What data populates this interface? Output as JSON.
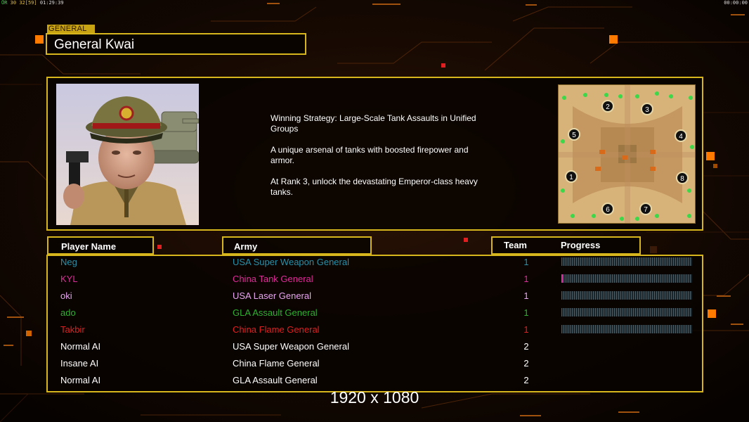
{
  "hud": {
    "left_prefix": "ŮR",
    "fps": "30",
    "fps_cap": "32",
    "fps_bracket": "[59]",
    "clock": "01:29:39",
    "right_clock": "00:00:00"
  },
  "general": {
    "section_label": "GENERAL",
    "name": "General Kwai",
    "description": "Winning Strategy: Large-Scale Tank Assaults in Unified\n Groups\n\nA unique arsenal of tanks with boosted firepower and\n armor.\n\nAt Rank 3, unlock the devastating Emperor-class heavy\n tanks.",
    "portrait_icon": "general-portrait-image",
    "map_icon": "minimap-image",
    "map_slots": [
      "1",
      "2",
      "3",
      "4",
      "5",
      "6",
      "7",
      "8"
    ]
  },
  "table": {
    "headers": {
      "player": "Player Name",
      "army": "Army",
      "team": "Team",
      "progress": "Progress"
    },
    "rows": [
      {
        "player": "Neg",
        "army": "USA Super Weapon General",
        "team": "1",
        "color": "#2a8fa8",
        "progress": 0.0,
        "show_progress": true
      },
      {
        "player": "KYL",
        "army": "China Tank General",
        "team": "1",
        "color": "#e02a9a",
        "progress": 0.01,
        "show_progress": true
      },
      {
        "player": "oki",
        "army": "USA Laser General",
        "team": "1",
        "color": "#e8a6f0",
        "progress": 0.0,
        "show_progress": true
      },
      {
        "player": "ado",
        "army": "GLA Assault General",
        "team": "1",
        "color": "#2fb02f",
        "progress": 0.0,
        "show_progress": true
      },
      {
        "player": "Takbir",
        "army": "China Flame General",
        "team": "1",
        "color": "#e02020",
        "progress": 0.0,
        "show_progress": true
      },
      {
        "player": "Normal AI",
        "army": "USA Super Weapon General",
        "team": "2",
        "color": "#ffffff",
        "progress": null,
        "show_progress": false
      },
      {
        "player": "Insane AI",
        "army": "China Flame General",
        "team": "2",
        "color": "#ffffff",
        "progress": null,
        "show_progress": false
      },
      {
        "player": "Normal AI",
        "army": "GLA Assault General",
        "team": "2",
        "color": "#ffffff",
        "progress": null,
        "show_progress": false
      }
    ]
  },
  "resolution_label": "1920 x 1080",
  "colors": {
    "frame": "#d7b51c",
    "accent": "#ff7a00",
    "background": "#0a0401"
  }
}
